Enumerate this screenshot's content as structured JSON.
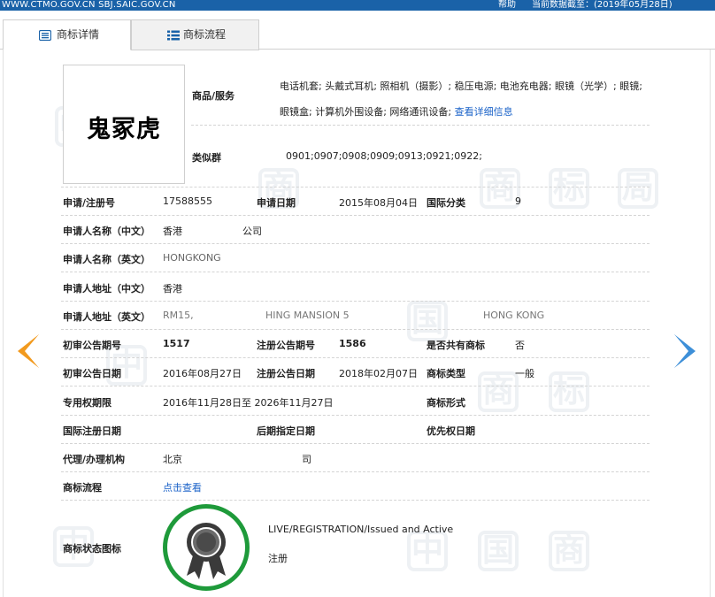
{
  "topbar": {
    "site": "WWW.CTMO.GOV.CN SBJ.SAIC.GOV.CN",
    "help": "帮助",
    "date_label": "当前数据截至：",
    "date_value": "(2019年05月28日)"
  },
  "tabs": [
    {
      "label": "商标详情",
      "icon": "detail-icon",
      "active": true
    },
    {
      "label": "商标流程",
      "icon": "list-icon",
      "active": false
    }
  ],
  "trademark": {
    "image_text": "鬼冢虎",
    "goods_label": "商品/服务",
    "goods_text": "电话机套; 头戴式耳机; 照相机（摄影）; 稳压电源; 电池充电器; 眼镜（光学）; 眼镜; 眼镜盒; 计算机外围设备; 网络通讯设备;",
    "goods_link": "查看详细信息",
    "similar_label": "类似群",
    "similar_value": "0901;0907;0908;0909;0913;0921;0922;"
  },
  "fields": {
    "reg_no_label": "申请/注册号",
    "reg_no": "17588555",
    "app_date_label": "申请日期",
    "app_date": "2015年08月04日",
    "intl_class_label": "国际分类",
    "intl_class": "9",
    "applicant_cn_label": "申请人名称（中文）",
    "applicant_cn_prefix": "香港",
    "applicant_cn_suffix": "公司",
    "applicant_en_label": "申请人名称（英文）",
    "applicant_en": "HONGKONG",
    "address_cn_label": "申请人地址（中文）",
    "address_cn": "香港",
    "address_en_label": "申请人地址（英文）",
    "address_en_a": "RM15,",
    "address_en_b": "HING MANSION 5",
    "address_en_c": "HONG KONG",
    "prelim_no_label": "初审公告期号",
    "prelim_no": "1517",
    "reg_pub_no_label": "注册公告期号",
    "reg_pub_no": "1586",
    "shared_label": "是否共有商标",
    "shared": "否",
    "prelim_date_label": "初审公告日期",
    "prelim_date": "2016年08月27日",
    "reg_pub_date_label": "注册公告日期",
    "reg_pub_date": "2018年02月07日",
    "tm_type_label": "商标类型",
    "tm_type": "一般",
    "exclusive_label": "专用权期限",
    "exclusive": "2016年11月28日至 2026年11月27日",
    "tm_form_label": "商标形式",
    "intl_reg_date_label": "国际注册日期",
    "later_date_label": "后期指定日期",
    "priority_date_label": "优先权日期",
    "agent_label": "代理/办理机构",
    "agent_prefix": "北京",
    "agent_suffix": "司",
    "process_label": "商标流程",
    "process_link": "点击查看",
    "status_icon_label": "商标状态图标",
    "status_en": "LIVE/REGISTRATION/Issued and Active",
    "status_cn": "注册"
  },
  "colors": {
    "topbar": "#1a62a8",
    "link": "#1a62c8",
    "arrow_left": "#f29a1e",
    "arrow_right": "#3d8fd8",
    "seal_ring": "#1e9a3a"
  }
}
